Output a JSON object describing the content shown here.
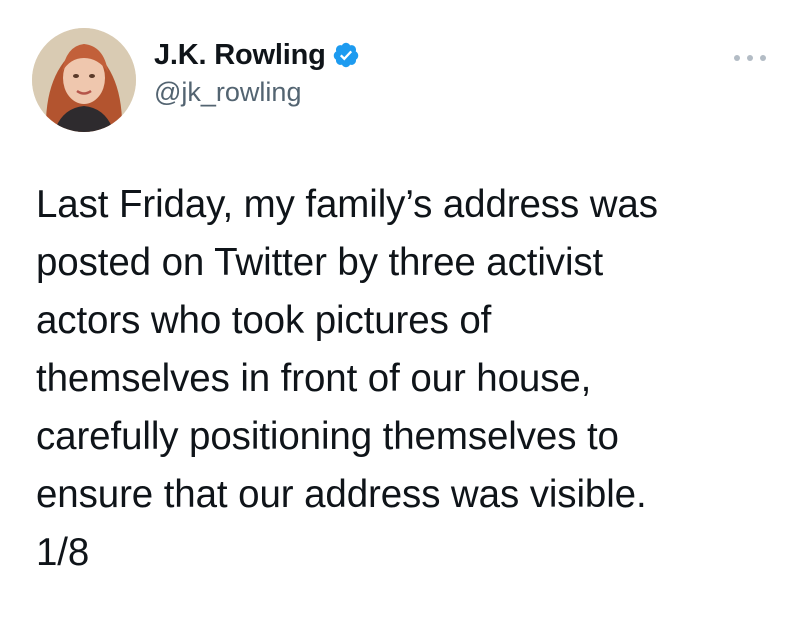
{
  "author": {
    "display_name": "J.K. Rowling",
    "handle": "@jk_rowling",
    "verified": true,
    "verified_icon": "verified-badge-icon",
    "verified_color": "#1d9bf0"
  },
  "actions": {
    "more_icon": "more-horizontal-icon"
  },
  "tweet": {
    "text": "Last Friday, my family’s address was\nposted on Twitter by three activist\nactors who took pictures of\nthemselves in front of our house,\ncarefully positioning themselves to\nensure that our address was visible.\n1/8"
  },
  "colors": {
    "text": "#0f1419",
    "secondary_text": "#536471",
    "accent": "#1d9bf0"
  }
}
